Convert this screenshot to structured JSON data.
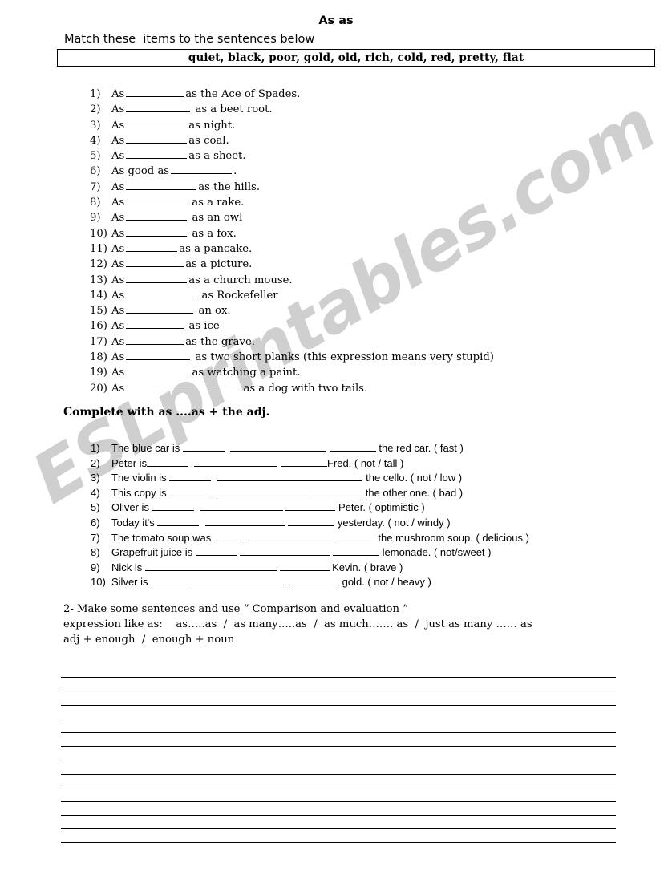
{
  "title": "As as",
  "watermark": {
    "text": "ESLprintables.com"
  },
  "instruction_1": "Match these  items to the sentences below",
  "word_bank": "quiet, black, poor, gold, old, rich, cold, red, pretty, flat",
  "exercise_1": {
    "items": [
      {
        "num": "1)",
        "lead": "As",
        "blank_width": 72,
        "tail": "as the Ace of Spades."
      },
      {
        "num": "2)",
        "lead": "As",
        "blank_width": 80,
        "tail": " as a beet root."
      },
      {
        "num": "3)",
        "lead": "As",
        "blank_width": 76,
        "tail": "as night."
      },
      {
        "num": "4)",
        "lead": "As",
        "blank_width": 76,
        "tail": "as coal."
      },
      {
        "num": "5)",
        "lead": "As",
        "blank_width": 76,
        "tail": "as a sheet."
      },
      {
        "num": "6)",
        "lead": "As good as",
        "blank_width": 76,
        "tail": "."
      },
      {
        "num": "7)",
        "lead": "As",
        "blank_width": 88,
        "tail": "as the hills."
      },
      {
        "num": "8)",
        "lead": "As",
        "blank_width": 80,
        "tail": "as a rake."
      },
      {
        "num": "9)",
        "lead": "As",
        "blank_width": 76,
        "tail": " as an owl"
      },
      {
        "num": "10)",
        "lead": "As",
        "blank_width": 76,
        "tail": " as a fox."
      },
      {
        "num": "11)",
        "lead": "As",
        "blank_width": 64,
        "tail": "as a pancake."
      },
      {
        "num": "12)",
        "lead": "As",
        "blank_width": 72,
        "tail": "as a picture."
      },
      {
        "num": "13)",
        "lead": "As",
        "blank_width": 76,
        "tail": "as a church mouse."
      },
      {
        "num": "14)",
        "lead": "As",
        "blank_width": 88,
        "tail": " as Rockefeller"
      },
      {
        "num": "15)",
        "lead": "As",
        "blank_width": 84,
        "tail": " an ox."
      },
      {
        "num": "16)",
        "lead": "As",
        "blank_width": 72,
        "tail": " as ice"
      },
      {
        "num": "17)",
        "lead": "As",
        "blank_width": 72,
        "tail": "as the grave."
      },
      {
        "num": "18)",
        "lead": "As",
        "blank_width": 80,
        "tail": " as two short planks (this expression means very stupid)"
      },
      {
        "num": "19)",
        "lead": "As",
        "blank_width": 76,
        "tail": " as watching a paint."
      },
      {
        "num": "20)",
        "lead": "As",
        "blank_width": 140,
        "tail": " as a dog with two tails."
      }
    ]
  },
  "instruction_2": "Complete with as ....as + the adj.",
  "exercise_2": {
    "items": [
      {
        "num": "1)",
        "lead": "The blue car is ",
        "b1": 52,
        "mid": "  ",
        "b2": 120,
        "gap": " ",
        "b3": 58,
        "tail": " the red car. ( fast )"
      },
      {
        "num": "2)",
        "lead": "Peter is",
        "b1": 52,
        "mid": "  ",
        "b2": 104,
        "gap": " ",
        "b3": 58,
        "tail": "Fred. ( not / tall )"
      },
      {
        "num": "3)",
        "lead": "The violin is ",
        "b1": 52,
        "mid": "  ",
        "b2": 120,
        "gap": "",
        "b3": 62,
        "tail": " the cello. ( not / low )"
      },
      {
        "num": "4)",
        "lead": "This copy is ",
        "b1": 52,
        "mid": "  ",
        "b2": 116,
        "gap": " ",
        "b3": 62,
        "tail": " the other one. ( bad )"
      },
      {
        "num": "5)",
        "lead": "Oliver is ",
        "b1": 52,
        "mid": "  ",
        "b2": 104,
        "gap": " ",
        "b3": 62,
        "tail": " Peter. ( optimistic )"
      },
      {
        "num": "6)",
        "lead": "Today it's ",
        "b1": 52,
        "mid": "  ",
        "b2": 100,
        "gap": " ",
        "b3": 58,
        "tail": " yesterday. ( not / windy )"
      },
      {
        "num": "7)",
        "lead": "The tomato soup was ",
        "b1": 36,
        "mid": " ",
        "b2": 112,
        "gap": " ",
        "b3": 42,
        "tail": "  the mushroom soup. ( delicious )"
      },
      {
        "num": "8)",
        "lead": "Grapefruit juice is ",
        "b1": 52,
        "mid": " ",
        "b2": 112,
        "gap": " ",
        "b3": 58,
        "tail": " lemonade. ( not/sweet )"
      },
      {
        "num": "9)",
        "lead": "Nick is ",
        "b1": 58,
        "mid": "",
        "b2": 106,
        "gap": " ",
        "b3": 62,
        "tail": " Kevin. ( brave )"
      },
      {
        "num": "10)",
        "lead": "Silver is ",
        "b1": 46,
        "mid": " ",
        "b2": 116,
        "gap": "  ",
        "b3": 62,
        "tail": " gold. ( not / heavy )"
      }
    ]
  },
  "instruction_3": "2- Make some sentences and use “ Comparison and evaluation “\nexpression like as:    as…..as  /  as many…..as  /  as much……. as  /  just as many …… as\nadj + enough  /  enough + noun",
  "answer_lines": {
    "count": 13
  }
}
